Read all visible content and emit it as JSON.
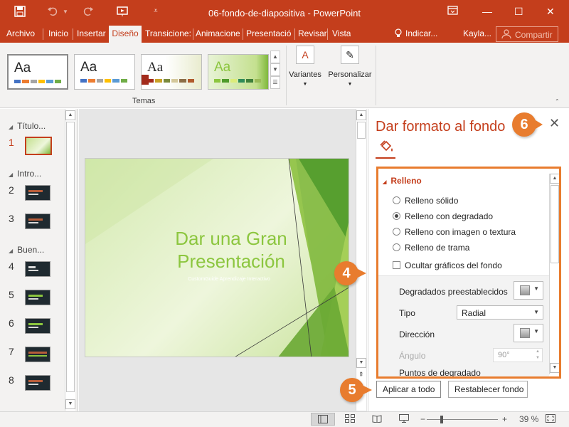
{
  "window": {
    "title": "06-fondo-de-diapositiva - PowerPoint",
    "quick_access": {
      "save_icon": "save-icon",
      "undo_icon": "undo-icon",
      "redo_icon": "redo-icon",
      "present_icon": "present-from-beginning-icon",
      "customize_icon": "customize-qat-icon"
    },
    "controls": {
      "restore_ribbon_icon": "ribbon-display-icon",
      "minimize": "—",
      "maximize": "☐",
      "close": "✕"
    }
  },
  "tabs": [
    "Archivo",
    "Inicio",
    "Insertar",
    "Diseño",
    "Transicione:",
    "Animacione",
    "Presentació",
    "Revisar",
    "Vista"
  ],
  "active_tab": "Diseño",
  "tell_me": "Indicar...",
  "user": "Kayla...",
  "share_label": "Compartir",
  "ribbon": {
    "themes_group_label": "Temas",
    "themes": [
      {
        "sample": "Aa"
      },
      {
        "sample": "Aa"
      },
      {
        "sample": "Aa"
      },
      {
        "sample": "Aa"
      }
    ],
    "variantes_label": "Variantes",
    "personalizar_label": "Personalizar"
  },
  "slide_pane": {
    "sections": [
      {
        "label": "Título..."
      },
      {
        "label": "Intro..."
      },
      {
        "label": "Buen..."
      }
    ],
    "slide_numbers": [
      "1",
      "2",
      "3",
      "4",
      "5",
      "6",
      "7",
      "8"
    ],
    "selected_slide": "1"
  },
  "slide": {
    "title_line1": "Dar una Gran",
    "title_line2": "Presentación",
    "subtitle": "CustomGuide Aprendizaje Interactivo"
  },
  "format_panel": {
    "title": "Dar formato al fondo",
    "fill_icon": "paint-bucket-icon",
    "section_header": "Relleno",
    "options": [
      {
        "label": "Relleno sólido",
        "selected": false
      },
      {
        "label": "Relleno con degradado",
        "selected": true
      },
      {
        "label": "Relleno con imagen o textura",
        "selected": false
      },
      {
        "label": "Relleno de trama",
        "selected": false
      }
    ],
    "hide_graphics_label": "Ocultar gráficos del fondo",
    "hide_graphics_checked": false,
    "preset_gradients_label": "Degradados preestablecidos",
    "type_label": "Tipo",
    "type_value": "Radial",
    "direction_label": "Dirección",
    "angle_label": "Ángulo",
    "angle_value": "90°",
    "gradient_stops_label": "Puntos de degradado",
    "apply_all_label": "Aplicar a todo",
    "reset_label": "Restablecer fondo"
  },
  "callouts": [
    "4",
    "5",
    "6"
  ],
  "status_bar": {
    "zoom_minus": "−",
    "zoom_plus": "+",
    "zoom_percent": "39 %",
    "zoom_fraction": 0.39
  },
  "colors": {
    "accent": "#c43e1c",
    "callout": "#e87c2e",
    "slide_title": "#8cc63f"
  }
}
